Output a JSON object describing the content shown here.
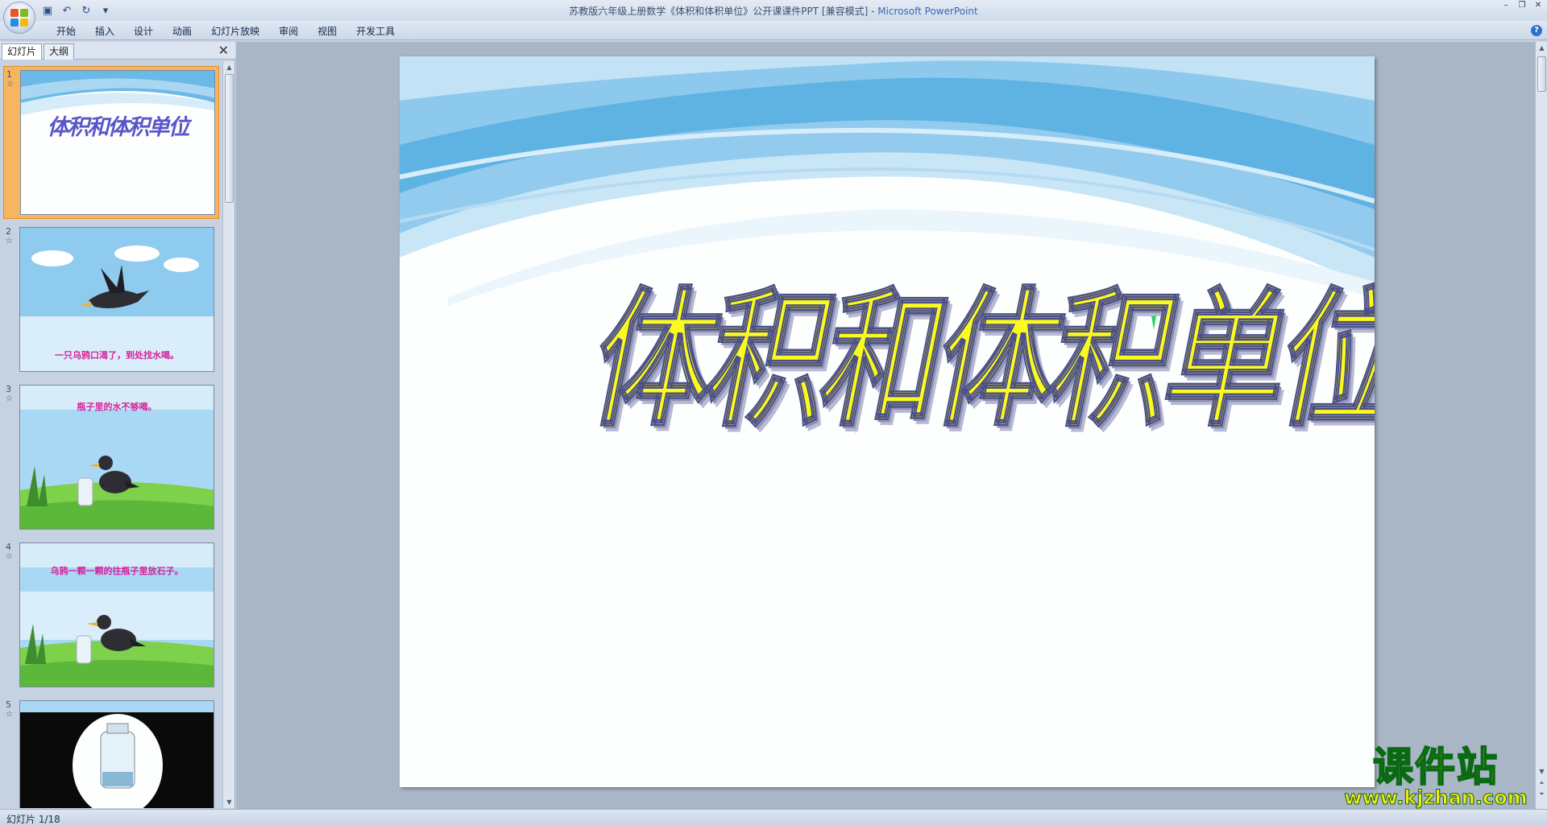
{
  "window": {
    "title": "苏教版六年级上册数学《体积和体积单位》公开课课件PPT [兼容模式] - ",
    "app_name": "Microsoft PowerPoint"
  },
  "quick_access": [
    {
      "name": "save-icon",
      "glyph": "▣"
    },
    {
      "name": "undo-icon",
      "glyph": "↶"
    },
    {
      "name": "redo-icon",
      "glyph": "↻"
    },
    {
      "name": "customize-icon",
      "glyph": "▾"
    }
  ],
  "ribbon_tabs": [
    "开始",
    "插入",
    "设计",
    "动画",
    "幻灯片放映",
    "审阅",
    "视图",
    "开发工具"
  ],
  "pane_tabs": {
    "slides": "幻灯片",
    "outline": "大纲"
  },
  "thumbnails": [
    {
      "number": "1",
      "caption": "体积和体积单位"
    },
    {
      "number": "2",
      "caption": "一只乌鸦口渴了，到处找水喝。"
    },
    {
      "number": "3",
      "caption": "瓶子里的水不够喝。"
    },
    {
      "number": "4",
      "caption": "乌鸦一颗一颗的往瓶子里放石子。"
    },
    {
      "number": "5",
      "caption": ""
    }
  ],
  "slide": {
    "title": "体积和体积单位"
  },
  "watermark": {
    "main": "课件站",
    "url": "www.kjzhan.com"
  },
  "status": {
    "slide_counter": "幻灯片 1/18"
  },
  "colors": {
    "title_fill": "#fbfa1e",
    "title_outline": "#4b4f8a",
    "selected_thumb": "#f6b560",
    "sky": "#5fb3e3"
  }
}
